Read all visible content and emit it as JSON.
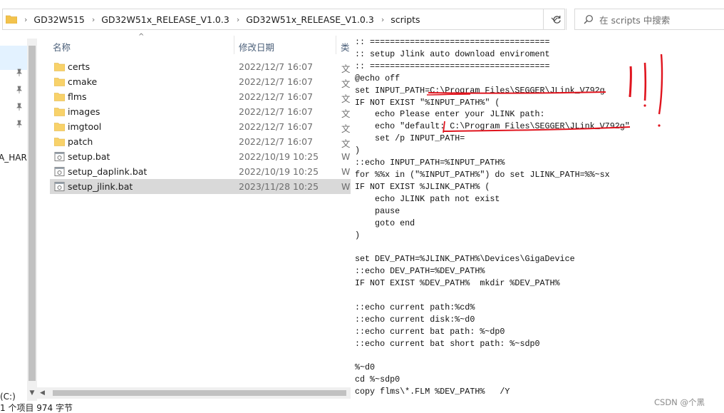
{
  "address_bar": {
    "crumbs": [
      "GD32W515",
      "GD32W51x_RELEASE_V1.0.3",
      "GD32W51x_RELEASE_V1.0.3",
      "scripts"
    ],
    "separator": "›"
  },
  "search": {
    "placeholder": "在 scripts 中搜索"
  },
  "nav": {
    "label_partial": "A_HARI",
    "drive_partial": "(C:)"
  },
  "columns": {
    "name": "名称",
    "date": "修改日期",
    "type": "类"
  },
  "files": [
    {
      "name": "certs",
      "date": "2022/12/7 16:07",
      "type": "文",
      "icon": "folder-icon"
    },
    {
      "name": "cmake",
      "date": "2022/12/7 16:07",
      "type": "文",
      "icon": "folder-icon"
    },
    {
      "name": "flms",
      "date": "2022/12/7 16:07",
      "type": "文",
      "icon": "folder-icon"
    },
    {
      "name": "images",
      "date": "2022/12/7 16:07",
      "type": "文",
      "icon": "folder-icon"
    },
    {
      "name": "imgtool",
      "date": "2022/12/7 16:07",
      "type": "文",
      "icon": "folder-icon"
    },
    {
      "name": "patch",
      "date": "2022/12/7 16:07",
      "type": "文",
      "icon": "folder-icon"
    },
    {
      "name": "setup.bat",
      "date": "2022/10/19 10:25",
      "type": "W",
      "icon": "bat-file-icon"
    },
    {
      "name": "setup_daplink.bat",
      "date": "2022/10/19 10:25",
      "type": "W",
      "icon": "bat-file-icon"
    },
    {
      "name": "setup_jlink.bat",
      "date": "2023/11/28 10:25",
      "type": "W",
      "icon": "bat-file-icon"
    }
  ],
  "preview": {
    "lines": [
      ":: ====================================",
      ":: setup Jlink auto download enviroment",
      ":: ====================================",
      "@echo off",
      "set INPUT_PATH=C:\\Program Files\\SEGGER\\JLink_V792g",
      "IF NOT EXIST \"%INPUT_PATH%\" (",
      "    echo Please enter your JLINK path:",
      "    echo \"default: C:\\Program Files\\SEGGER\\JLink_V792g\"",
      "    set /p INPUT_PATH=",
      ")",
      "::echo INPUT_PATH=%INPUT_PATH%",
      "for %%x in (\"%INPUT_PATH%\") do set JLINK_PATH=%%~sx",
      "IF NOT EXIST %JLINK_PATH% (",
      "    echo JLINK path not exist",
      "    pause",
      "    goto end",
      ")",
      "",
      "set DEV_PATH=%JLINK_PATH%\\Devices\\GigaDevice",
      "::echo DEV_PATH=%DEV_PATH%",
      "IF NOT EXIST %DEV_PATH%  mkdir %DEV_PATH%",
      "",
      "::echo current path:%cd%",
      "::echo current disk:%~d0",
      "::echo current bat path: %~dp0",
      "::echo current bat short path: %~sdp0",
      "",
      "%~d0",
      "cd %~sdp0",
      "copy flms\\*.FLM %DEV_PATH%   /Y"
    ]
  },
  "status_bar": {
    "text": "1 个项目   974 字节"
  },
  "watermark": "CSDN @个黑",
  "colors": {
    "annotation": "#e0141e",
    "selection": "#d9d9d9",
    "header_text": "#4c607a"
  }
}
